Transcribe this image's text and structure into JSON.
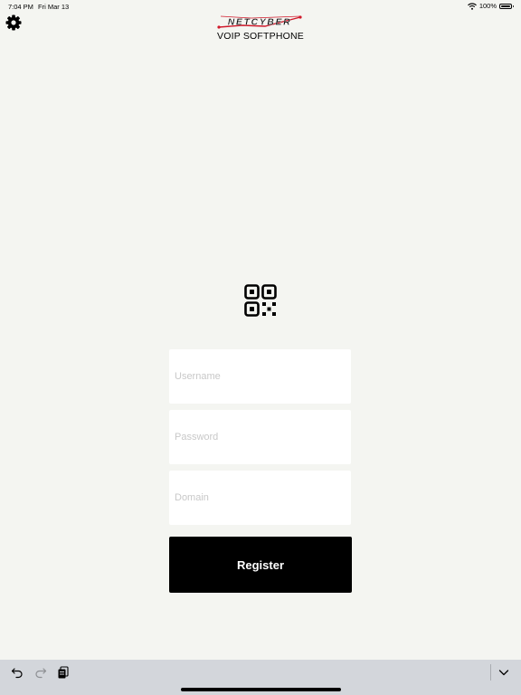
{
  "status_bar": {
    "time": "7:04 PM",
    "date": "Fri Mar 13",
    "battery": "100%",
    "battery_level": 1.0
  },
  "header": {
    "logo_text": "NETCYBER",
    "subtitle": "VOIP SOFTPHONE"
  },
  "icons": {
    "settings": "gear-icon",
    "scan": "qr-code-icon",
    "undo": "undo-icon",
    "redo": "redo-icon",
    "paste": "clipboard-icon",
    "dismiss": "chevron-down-icon"
  },
  "form": {
    "username_placeholder": "Username",
    "password_placeholder": "Password",
    "domain_placeholder": "Domain",
    "register_label": "Register"
  },
  "colors": {
    "background": "#f4f5f1",
    "button": "#000000",
    "logo_accent": "#d0192b",
    "toolbar": "#d3d6db"
  }
}
